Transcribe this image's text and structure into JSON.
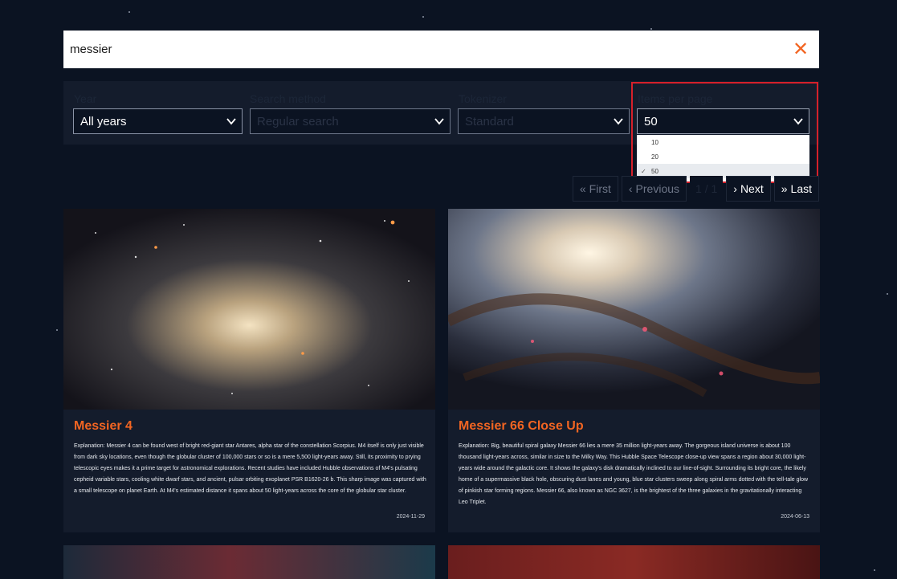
{
  "search": {
    "value": "messier",
    "clear_icon": "close-icon"
  },
  "filters": {
    "year": {
      "label": "Year",
      "value": "All years"
    },
    "method": {
      "label": "Search method",
      "value": "Regular search"
    },
    "tokenizer": {
      "label": "Tokenizer",
      "value": "Standard"
    },
    "per_page": {
      "label": "Items per page",
      "value": "50",
      "options": [
        "10",
        "20",
        "50"
      ]
    }
  },
  "pagination": {
    "first": "First",
    "previous": "Previous",
    "page": "1 / 1",
    "next": "Next",
    "last": "Last"
  },
  "cards": [
    {
      "title": "Messier 4",
      "explanation": "Explanation: Messier 4 can be found west of bright red-giant star Antares, alpha star of the constellation Scorpius. M4 itself is only just visible from dark sky locations, even though the globular cluster of 100,000 stars or so is a mere 5,500 light-years away. Still, its proximity to prying telescopic eyes makes it a prime target for astronomical explorations. Recent studies have included Hubble observations of M4's pulsating cepheid variable stars, cooling white dwarf stars, and ancient, pulsar orbiting exoplanet PSR B1620-26 b. This sharp image was captured with a small telescope on planet Earth. At M4's estimated distance it spans about 50 light-years across the core of the globular star cluster.",
      "date": "2024-11-29"
    },
    {
      "title": "Messier 66 Close Up",
      "explanation": "Explanation: Big, beautiful spiral galaxy Messier 66 lies a mere 35 million light-years away. The gorgeous island universe is about 100 thousand light-years across, similar in size to the Milky Way. This Hubble Space Telescope close-up view spans a region about 30,000 light-years wide around the galactic core. It shows the galaxy's disk dramatically inclined to our line-of-sight. Surrounding its bright core, the likely home of a supermassive black hole, obscuring dust lanes and young, blue star clusters sweep along spiral arms dotted with the tell-tale glow of pinkish star forming regions. Messier 66, also known as NGC 3627, is the brightest of the three galaxies in the gravitationally interacting Leo Triplet.",
      "date": "2024-06-13"
    }
  ],
  "colors": {
    "accent": "#f26522",
    "background": "#0b1322",
    "panel": "#141c2c",
    "highlight": "#d6202a"
  }
}
